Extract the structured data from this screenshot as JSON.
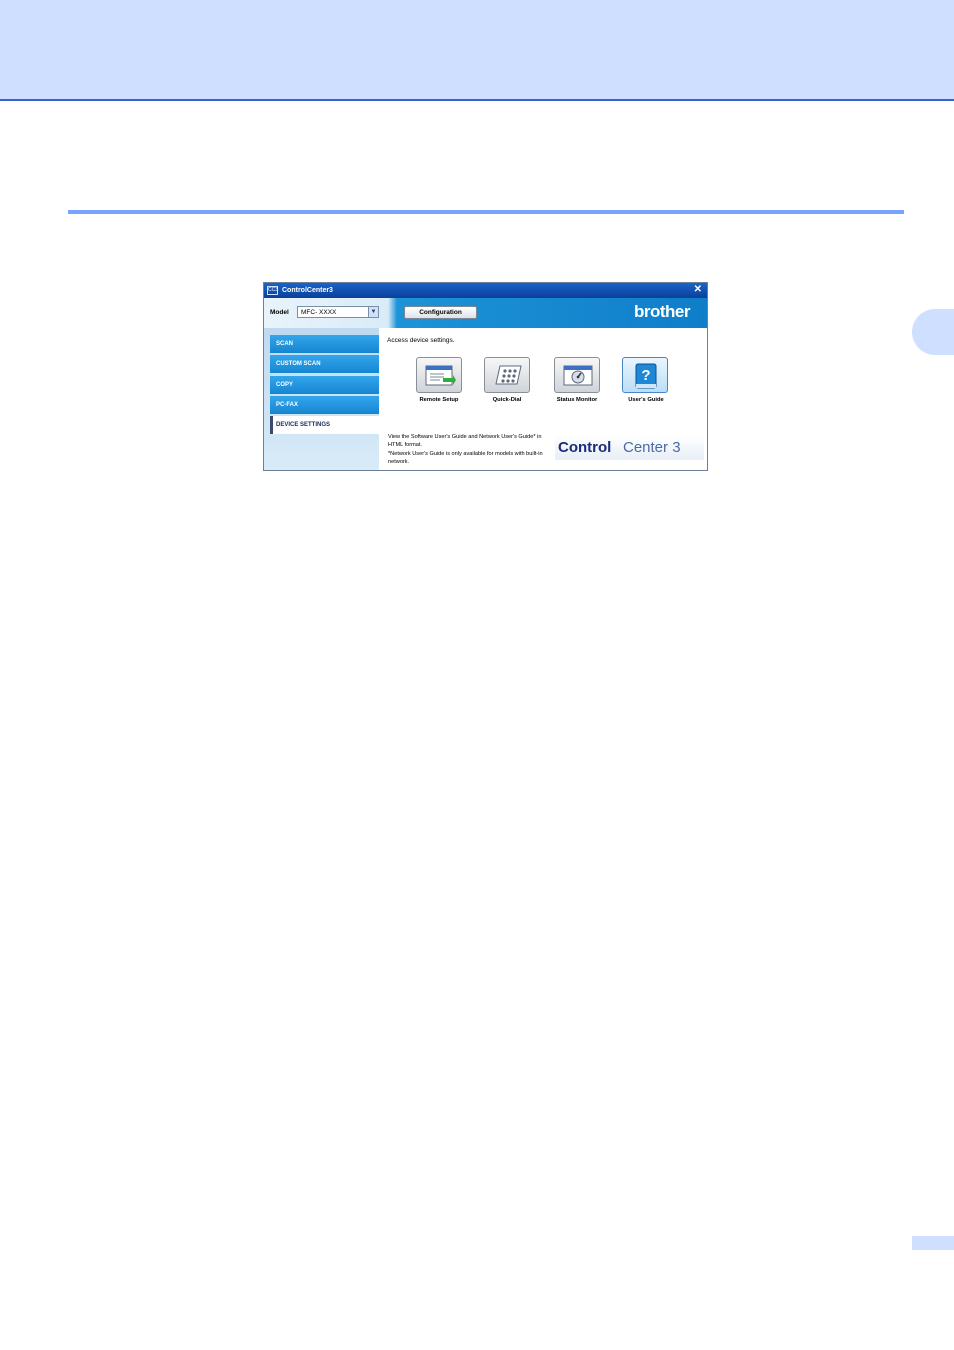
{
  "window": {
    "title": "ControlCenter3",
    "icon_text": "CC3",
    "close": "✕"
  },
  "toolbar": {
    "model_label": "Model",
    "model_value": "MFC- XXXX",
    "dropdown_arrow": "▼",
    "config_button": "Configuration",
    "brand": "brother"
  },
  "sidebar": {
    "items": [
      {
        "label": "SCAN"
      },
      {
        "label": "CUSTOM SCAN"
      },
      {
        "label": "COPY"
      },
      {
        "label": "PC-FAX"
      },
      {
        "label": "DEVICE SETTINGS"
      }
    ]
  },
  "content": {
    "access_text": "Access device settings.",
    "buttons": [
      {
        "label": "Remote Setup",
        "icon": "remote-setup-icon"
      },
      {
        "label": "Quick-Dial",
        "icon": "quick-dial-icon"
      },
      {
        "label": "Status Monitor",
        "icon": "status-monitor-icon"
      },
      {
        "label": "User's Guide",
        "icon": "users-guide-icon"
      }
    ],
    "info_line1": "View the Software User's Guide and Network User's Guide* in HTML format.",
    "info_line2": "*Network User's Guide is only available for models with built-in network."
  },
  "logo": {
    "control": "Control",
    "center": "Center 3"
  },
  "colors": {
    "header_band": "#cfdfff",
    "rule": "#7aa2ff",
    "titlebar": "#0b3f9a",
    "nav": "#1f8fdc"
  }
}
